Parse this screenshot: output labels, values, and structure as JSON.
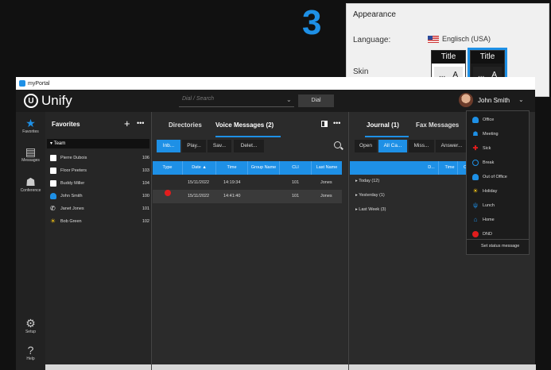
{
  "step": "3",
  "appearance": {
    "title": "Appearance",
    "language_label": "Language:",
    "language_value": "Englisch (USA)",
    "skin_label": "Skin",
    "skin_light": {
      "title": "Title",
      "left": "...",
      "right": "A"
    },
    "skin_dark": {
      "title": "Title",
      "left": "...",
      "right": "A"
    }
  },
  "window": {
    "title": "myPortal"
  },
  "topbar": {
    "brand": "Unify",
    "dial_placeholder": "Dial / Search",
    "dial_button": "Dial",
    "user_name": "John Smith"
  },
  "sidebar": {
    "items": [
      {
        "label": "Favorites",
        "icon": "star-icon"
      },
      {
        "label": "Messages",
        "icon": "messages-icon"
      },
      {
        "label": "Conference",
        "icon": "conference-icon"
      },
      {
        "label": "Setup",
        "icon": "gear-icon"
      },
      {
        "label": "Help",
        "icon": "help-icon"
      }
    ]
  },
  "favorites": {
    "title": "Favorites",
    "group": "Team",
    "contacts": [
      {
        "name": "Pierre Dubois",
        "ext": "106"
      },
      {
        "name": "Floor Peeters",
        "ext": "103"
      },
      {
        "name": "Buddy Miller",
        "ext": "104"
      },
      {
        "name": "John Smith",
        "ext": "100"
      },
      {
        "name": "Janet Jones",
        "ext": "101"
      },
      {
        "name": "Bob Green",
        "ext": "102"
      }
    ]
  },
  "voice": {
    "tabs": [
      "Directories",
      "Voice Messages (2)"
    ],
    "buttons": [
      "Inb...",
      "Play...",
      "Sav...",
      "Delet..."
    ],
    "columns": [
      "Type",
      "Date ▲",
      "Time",
      "Group Name",
      "CLI",
      "Last Name"
    ],
    "rows": [
      {
        "date": "15/11/2022",
        "time": "14:19:34",
        "cli": "101",
        "last": "Jones"
      },
      {
        "date": "15/11/2022",
        "time": "14:41:40",
        "cli": "101",
        "last": "Jones"
      }
    ]
  },
  "journal": {
    "tabs": [
      "Journal (1)",
      "Fax Messages"
    ],
    "buttons": [
      "Open",
      "All Ca...",
      "Miss...",
      "Answer..."
    ],
    "columns": [
      "D...",
      "Time",
      "C"
    ],
    "groups": [
      "Today (12)",
      "Yesterday (1)",
      "Last Week (3)"
    ]
  },
  "status_menu": {
    "items": [
      {
        "label": "Office",
        "icon": "office-icon"
      },
      {
        "label": "Meeting",
        "icon": "meeting-icon"
      },
      {
        "label": "Sick",
        "icon": "sick-icon"
      },
      {
        "label": "Break",
        "icon": "break-icon"
      },
      {
        "label": "Out of Office",
        "icon": "out-of-office-icon"
      },
      {
        "label": "Holiday",
        "icon": "holiday-icon"
      },
      {
        "label": "Lunch",
        "icon": "lunch-icon"
      },
      {
        "label": "Home",
        "icon": "home-icon"
      },
      {
        "label": "DND",
        "icon": "dnd-icon"
      }
    ],
    "set_status": "Set status message"
  },
  "colors": {
    "accent": "#1e90e6",
    "dnd": "#e21d1d",
    "background": "#2a2a2a"
  }
}
